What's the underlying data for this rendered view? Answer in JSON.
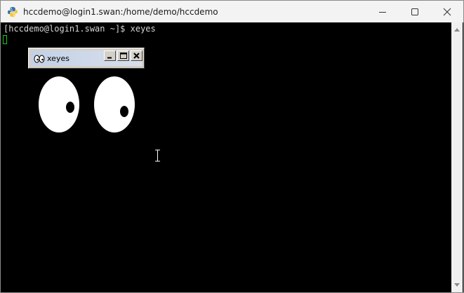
{
  "window": {
    "title": "hccdemo@login1.swan:/home/demo/hccdemo",
    "app_icon": "python-icon",
    "controls": [
      "minimize-icon",
      "maximize-icon",
      "close-icon"
    ]
  },
  "terminal": {
    "prompt_line": "[hccdemo@login1.swan ~]$ xeyes",
    "background": "#000000",
    "text_color": "#d4d4d4",
    "cursor_color": "#19c819"
  },
  "xeyes": {
    "title": "xeyes",
    "controls": [
      "minimize-icon",
      "maximize-icon",
      "close-icon"
    ]
  }
}
